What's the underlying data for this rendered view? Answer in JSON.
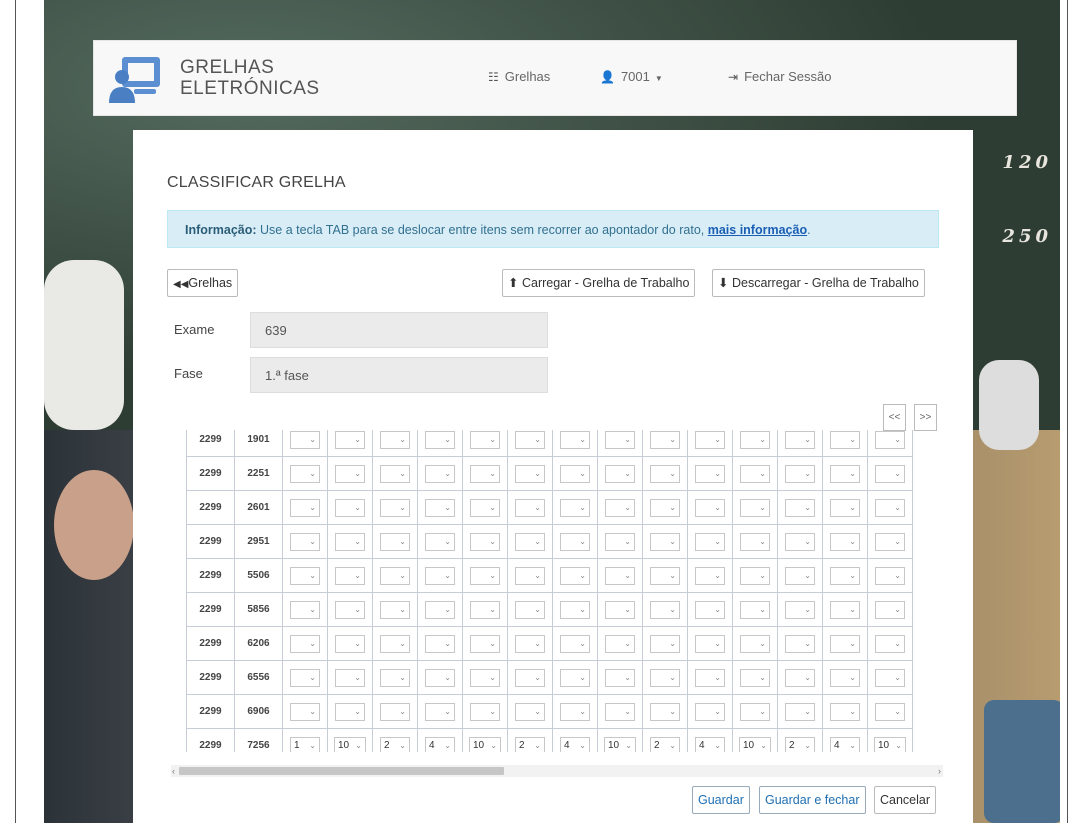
{
  "app": {
    "brand_line1": "GRELHAS",
    "brand_line2": "ELETRÓNICAS"
  },
  "nav": {
    "grelhas": "Grelhas",
    "user": "7001",
    "logout": "Fechar Sessão"
  },
  "background": {
    "chalk_line1": "120",
    "chalk_line2": "250"
  },
  "page": {
    "title": "CLASSIFICAR GRELHA",
    "info_label": "Informação:",
    "info_text": "Use a tecla TAB para se deslocar entre itens sem recorrer ao apontador do rato,",
    "info_link": "mais informação",
    "info_end": "."
  },
  "toolbar": {
    "back": "Grelhas",
    "upload": "Carregar - Grelha de Trabalho",
    "download": "Descarregar - Grelha de Trabalho"
  },
  "form": {
    "exame_label": "Exame",
    "exame_value": "639",
    "fase_label": "Fase",
    "fase_value": "1.ª fase"
  },
  "pager": {
    "prev": "<<",
    "next": ">>"
  },
  "grid": {
    "rows": [
      {
        "school": "2299",
        "student": "1901",
        "values": [
          "",
          "",
          "",
          "",
          "",
          "",
          "",
          "",
          "",
          "",
          "",
          "",
          "",
          ""
        ]
      },
      {
        "school": "2299",
        "student": "2251",
        "values": [
          "",
          "",
          "",
          "",
          "",
          "",
          "",
          "",
          "",
          "",
          "",
          "",
          "",
          ""
        ]
      },
      {
        "school": "2299",
        "student": "2601",
        "values": [
          "",
          "",
          "",
          "",
          "",
          "",
          "",
          "",
          "",
          "",
          "",
          "",
          "",
          ""
        ]
      },
      {
        "school": "2299",
        "student": "2951",
        "values": [
          "",
          "",
          "",
          "",
          "",
          "",
          "",
          "",
          "",
          "",
          "",
          "",
          "",
          ""
        ]
      },
      {
        "school": "2299",
        "student": "5506",
        "values": [
          "",
          "",
          "",
          "",
          "",
          "",
          "",
          "",
          "",
          "",
          "",
          "",
          "",
          ""
        ]
      },
      {
        "school": "2299",
        "student": "5856",
        "values": [
          "",
          "",
          "",
          "",
          "",
          "",
          "",
          "",
          "",
          "",
          "",
          "",
          "",
          ""
        ]
      },
      {
        "school": "2299",
        "student": "6206",
        "values": [
          "",
          "",
          "",
          "",
          "",
          "",
          "",
          "",
          "",
          "",
          "",
          "",
          "",
          ""
        ]
      },
      {
        "school": "2299",
        "student": "6556",
        "values": [
          "",
          "",
          "",
          "",
          "",
          "",
          "",
          "",
          "",
          "",
          "",
          "",
          "",
          ""
        ]
      },
      {
        "school": "2299",
        "student": "6906",
        "values": [
          "",
          "",
          "",
          "",
          "",
          "",
          "",
          "",
          "",
          "",
          "",
          "",
          "",
          ""
        ]
      },
      {
        "school": "2299",
        "student": "7256",
        "values": [
          "1",
          "10",
          "2",
          "4",
          "10",
          "2",
          "4",
          "10",
          "2",
          "4",
          "10",
          "2",
          "4",
          "10"
        ]
      }
    ]
  },
  "footer": {
    "save": "Guardar",
    "save_close": "Guardar e fechar",
    "cancel": "Cancelar"
  }
}
